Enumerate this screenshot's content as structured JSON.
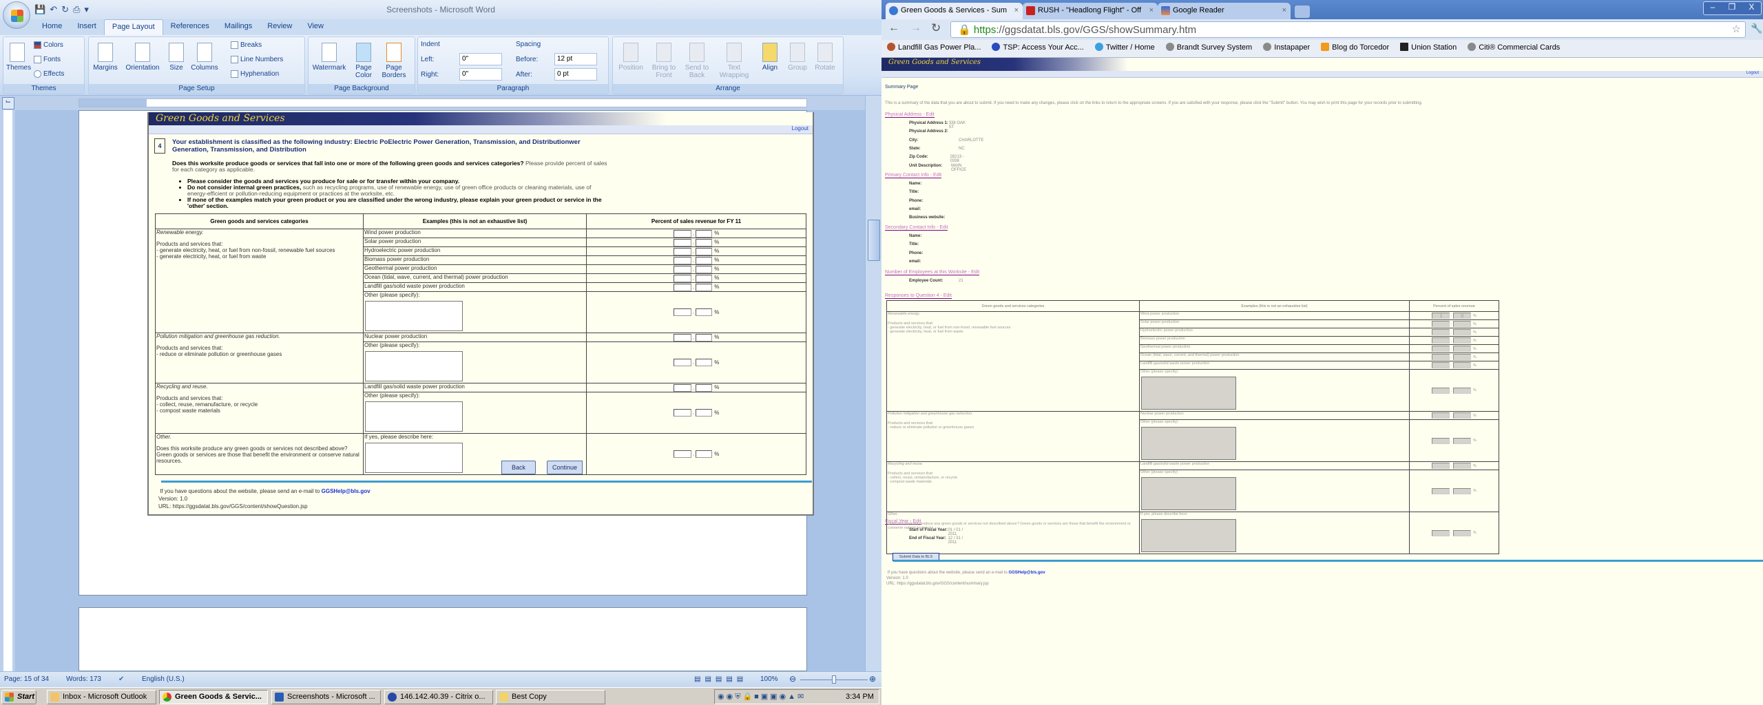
{
  "word": {
    "window_title": "Screenshots - Microsoft Word",
    "ribbon_tabs": [
      "Home",
      "Insert",
      "Page Layout",
      "References",
      "Mailings",
      "Review",
      "View"
    ],
    "active_tab": "Page Layout",
    "groups": {
      "themes": {
        "label": "Themes",
        "themes": "Themes",
        "colors": "Colors",
        "fonts": "Fonts",
        "effects": "Effects"
      },
      "page_setup": {
        "label": "Page Setup",
        "margins": "Margins",
        "orientation": "Orientation",
        "size": "Size",
        "columns": "Columns",
        "breaks": "Breaks",
        "line_numbers": "Line Numbers",
        "hyphenation": "Hyphenation"
      },
      "page_background": {
        "label": "Page Background",
        "watermark": "Watermark",
        "page_color": "Page Color",
        "page_borders": "Page Borders"
      },
      "paragraph": {
        "label": "Paragraph",
        "indent": "Indent",
        "left_label": "Left:",
        "left_value": "0\"",
        "right_label": "Right:",
        "right_value": "0\"",
        "spacing": "Spacing",
        "before_label": "Before:",
        "before_value": "12 pt",
        "after_label": "After:",
        "after_value": "0 pt"
      },
      "arrange": {
        "label": "Arrange",
        "position": "Position",
        "bring_to_front": "Bring to Front",
        "send_to_back": "Send to Back",
        "text_wrapping": "Text Wrapping",
        "align": "Align",
        "group": "Group",
        "rotate": "Rotate"
      }
    },
    "status": {
      "page": "Page: 15 of 34",
      "words": "Words: 173",
      "language": "English (U.S.)",
      "zoom": "100%",
      "zoom_level": 100
    }
  },
  "question_page": {
    "banner": "Green Goods and Services",
    "logout": "Logout",
    "question_number": "4",
    "heading": "Your establishment is classified as the following industry: Electric PoElectric Power Generation, Transmission, and Distributionwer Generation, Transmission, and Distribution",
    "lead_bold": "Does this worksite produce goods or services that fall into one or more of the following green goods and services categories?",
    "lead_normal": "Please provide percent of sales for each category as applicable.",
    "bullets": [
      {
        "bold": "Please consider the goods and services you produce for sale or for transfer within your company.",
        "normal": ""
      },
      {
        "bold": "Do not consider internal green practices,",
        "normal": "such as recycling programs, use of renewable energy, use of green office products or cleaning materials, use of energy-efficient or pollution-reducing equipment or practices at the worksite, etc."
      },
      {
        "bold": "If none of the examples match your green product or you are classified under the wrong industry, please explain your green product or service in the 'other' section.",
        "normal": ""
      }
    ],
    "table_headers": [
      "Green goods and services categories",
      "Examples (this is not an exhaustive list)",
      "Percent of sales revenue for FY 11"
    ],
    "back": "Back",
    "continue": "Continue",
    "footer_text": "If you have questions about the website, please send an e-mail to",
    "footer_email": "GGSHelp@bls.gov",
    "version": "Version: 1.0",
    "url": "URL: https://ggsdatat.bls.gov/GGS/content/showQuestion.jsp"
  },
  "categories": [
    {
      "title": "Renewable energy.",
      "intro": "Products and services that:",
      "lines": [
        "- generate electricity, heat, or fuel from non-fossil, renewable fuel sources",
        "- generate electricity, heat, or fuel from waste"
      ],
      "examples": [
        "Wind power production",
        "Solar power production",
        "Hydroelectric power production",
        "Biomass power production",
        "Geothermal power production",
        "Ocean (tidal, wave, current, and thermal) power production",
        "Landfill gas/solid waste power production"
      ],
      "other_label": "Other (please specify):"
    },
    {
      "title": "Pollution mitigation and greenhouse gas reduction.",
      "intro": "Products and services that:",
      "lines": [
        "- reduce or eliminate pollution or greenhouse gases"
      ],
      "examples": [
        "Nuclear power production"
      ],
      "other_label": "Other (please specify):"
    },
    {
      "title": "Recycling and reuse.",
      "intro": "Products and services that:",
      "lines": [
        "- collect, reuse, remanufacture, or recycle",
        "- compost waste materials"
      ],
      "examples": [
        "Landfill gas/solid waste power production"
      ],
      "other_label": "Other (please specify):"
    },
    {
      "title": "Other.",
      "intro": "Does this worksite produce any green goods or services not described above? Green goods or services are those that benefit the environment or conserve natural resources.",
      "lines": [],
      "examples": [],
      "other_label": "If yes, please describe here:"
    }
  ],
  "percent_sign": "%",
  "taskbar": {
    "start": "Start",
    "items": [
      "Inbox - Microsoft Outlook",
      "Green Goods & Servic...",
      "Screenshots - Microsoft ...",
      "146.142.40.39 - Citrix o...",
      "Best Copy"
    ],
    "clock": "3:34 PM"
  },
  "browser": {
    "tabs": [
      "Green Goods & Services - Sum",
      "RUSH - \"Headlong Flight\" - Off",
      "Google Reader"
    ],
    "url_scheme": "https",
    "url_rest": "://ggsdatat.bls.gov/GGS/showSummary.htm",
    "bookmarks": [
      "Landfill Gas Power Pla...",
      "TSP: Access Your Acc...",
      "Twitter / Home",
      "Brandt Survey System",
      "Instapaper",
      "Blog do Torcedor",
      "Union Station",
      "Citi® Commercial Cards"
    ],
    "page": {
      "banner": "Green Goods and Services",
      "logout": "Logout",
      "title": "Summary Page",
      "intro": "This is a summary of the data that you are about to submit. If you need to make any changes, please click on the links to return to the appropriate screens. If you are satisfied with your response, please click the \"Submit\" button. You may wish to print this page for your records prior to submitting.",
      "physical": {
        "link": "Physical Address - Edit",
        "fields": [
          [
            "Physical Address 1:",
            "338 OAK ST"
          ],
          [
            "Physical Address 2:",
            ""
          ],
          [
            "City:",
            "CHARLOTTE"
          ],
          [
            "State:",
            "NC"
          ],
          [
            "Zip Code:",
            "28213 - 0338"
          ],
          [
            "Unit Description:",
            "MAIN OFFICE"
          ]
        ]
      },
      "primary": {
        "link": "Primary Contact Info - Edit",
        "fields": [
          [
            "Name:",
            ""
          ],
          [
            "Title:",
            ""
          ],
          [
            "Phone:",
            ""
          ],
          [
            "email:",
            ""
          ],
          [
            "Business website:",
            ""
          ]
        ]
      },
      "secondary": {
        "link": "Secondary Contact Info - Edit",
        "fields": [
          [
            "Name:",
            ""
          ],
          [
            "Title:",
            ""
          ],
          [
            "Phone:",
            ""
          ],
          [
            "email:",
            ""
          ]
        ]
      },
      "employees": {
        "link": "Number of Employees at this Worksite - Edit",
        "fields": [
          [
            "Employee Count:",
            "21"
          ]
        ]
      },
      "responses_link": "Responses to Question 4 - Edit",
      "table_headers": [
        "Green goods and services categories",
        "Examples (this is not an exhaustive list)",
        "Percent of sales revenue"
      ],
      "wind_value": [
        "1",
        "0"
      ],
      "fiscal": {
        "link": "Fiscal Year - Edit",
        "fields": [
          [
            "Start of Fiscal Year:",
            "01 / 01 / 2011"
          ],
          [
            "End of Fiscal Year:",
            "12 / 31 / 2011"
          ]
        ]
      },
      "submit": "Submit Data to BLS",
      "footer_text": "If you have questions about the website, please send an e-mail to",
      "footer_email": "GGSHelp@bls.gov",
      "version": "Version: 1.0",
      "url": "URL: https://ggsdatat.bls.gov/GGS/content/summary.jsp"
    }
  }
}
